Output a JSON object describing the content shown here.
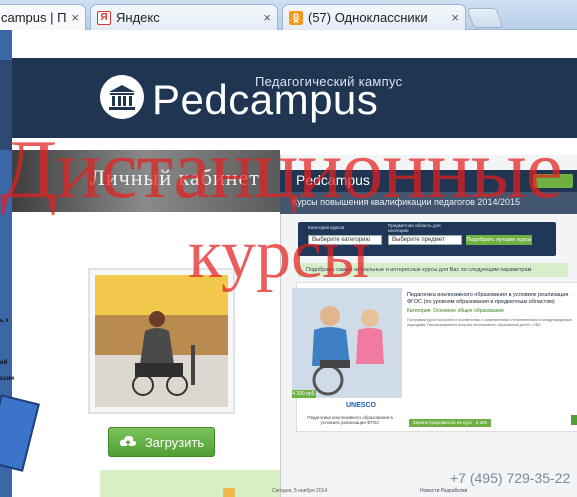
{
  "browser": {
    "tabs": [
      {
        "title": "campus | П",
        "favicon": "pedcampus",
        "active": true
      },
      {
        "title": "Яндекс",
        "favicon": "Я",
        "active": false
      },
      {
        "title": "(57) Одноклассники",
        "favicon": "ok",
        "active": false
      }
    ],
    "close_glyph": "×"
  },
  "site": {
    "tagline": "Педагогический кампус",
    "name": "Pedcampus",
    "cabinet_title": "Личный кабинет",
    "upload_button": "Загрузить"
  },
  "overlay_title": {
    "line1": "Дистанционные",
    "line2": "курсы"
  },
  "course_site": {
    "logo": "Pedcampus",
    "banner": "Курсы повышения квалификации педагогов 2014/2015",
    "filter": {
      "category_label": "Категория курсов",
      "category_value": "Выберите категорию",
      "subject_label": "Предметная область для категории",
      "subject_value": "Выберите предмет",
      "button": "Подобрать лучшие курсы"
    },
    "found_text": "Подобрано самые актуальные и интересные курсы для Вас по следующим параметрам",
    "card": {
      "title": "Педагогика инклюзивного образования в условиях реализации ФГОС (по уровням образования и предметным областям)",
      "category": "Категория: Основное общее образование",
      "body": "Программа курса построена в соответствии с современными отечественными и международными подходами. Рассматриваются вопросы инклюзивного образования детей с ОВЗ.",
      "price": "4 200 руб.",
      "unesco": "UNESCO",
      "caption": "Педагогика инклюзивного образования в условиях реализации ФГОС",
      "button": "Зарегистрироваться на курс · 4 200 руб."
    },
    "phone": "+7 (495) 729-35-22",
    "date": "Сегодня, 5 ноября 2014",
    "bottom_links": "Новости   Разработки"
  },
  "left_fragments": [
    "ь х",
    "ий",
    "ссии"
  ],
  "colors": {
    "header_bg": "#1f3552",
    "accent_green": "#6fb043",
    "overlay_red": "#e41e1e"
  }
}
